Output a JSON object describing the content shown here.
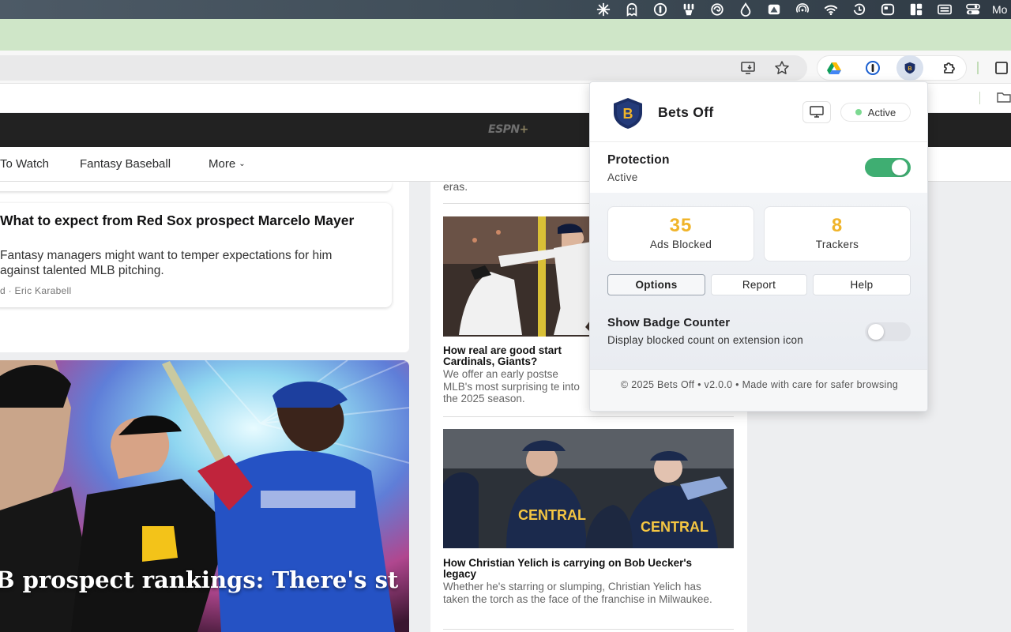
{
  "menubar": {
    "icons": [
      "sunburst-icon",
      "ghost-icon",
      "onepassword-icon",
      "paw-icon",
      "swirl-icon",
      "droplet-icon",
      "triangle-box-icon",
      "airdrop-icon",
      "wifi-icon",
      "timer-icon",
      "rounded-square-icon",
      "layout-icon",
      "keyboard-icon",
      "control-center-icon"
    ],
    "clock_text": "Mo"
  },
  "toolbar": {
    "icons": [
      "install-app-icon",
      "bookmark-star-icon",
      "google-drive-icon",
      "onepassword-icon",
      "bets-off-extension-icon",
      "extensions-puzzle-icon"
    ]
  },
  "espn": {
    "logo": "ESPN",
    "logo_plus": "+"
  },
  "subnav": {
    "items": [
      "To Watch",
      "Fantasy Baseball",
      "More"
    ]
  },
  "stories": {
    "feature": {
      "title": "What to expect from Red Sox prospect Marcelo Mayer",
      "desc": "Fantasy managers might want to temper expectations for him against talented MLB pitching.",
      "byline": "d · Eric Karabell"
    },
    "hero_title": "B prospect rankings: There's st"
  },
  "right_rail": {
    "snippet_top": "eras.",
    "item1": {
      "headline": "How real are good start Cardinals, Giants?",
      "desc": "We offer an early postse MLB's most surprising te into the 2025 season."
    },
    "item2": {
      "headline": "How Christian Yelich is carrying on Bob Uecker's legacy",
      "desc": "Whether he's starring or slumping, Christian Yelich has taken the torch as the face of the franchise in Milwaukee."
    }
  },
  "popup": {
    "logo_letter": "B",
    "title": "Bets Off",
    "status": "Active",
    "protection": {
      "label": "Protection",
      "state": "Active",
      "enabled": true
    },
    "stats": [
      {
        "value": "35",
        "label": "Ads Blocked"
      },
      {
        "value": "8",
        "label": "Trackers"
      }
    ],
    "buttons": [
      "Options",
      "Report",
      "Help"
    ],
    "badge": {
      "label": "Show Badge Counter",
      "desc": "Display blocked count on extension icon",
      "enabled": false
    },
    "footer": "© 2025 Bets Off • v2.0.0 • Made with care for safer browsing",
    "colors": {
      "accent": "#f0b42a",
      "toggle_on": "#3fae72",
      "shield_navy": "#1c2f66"
    }
  }
}
